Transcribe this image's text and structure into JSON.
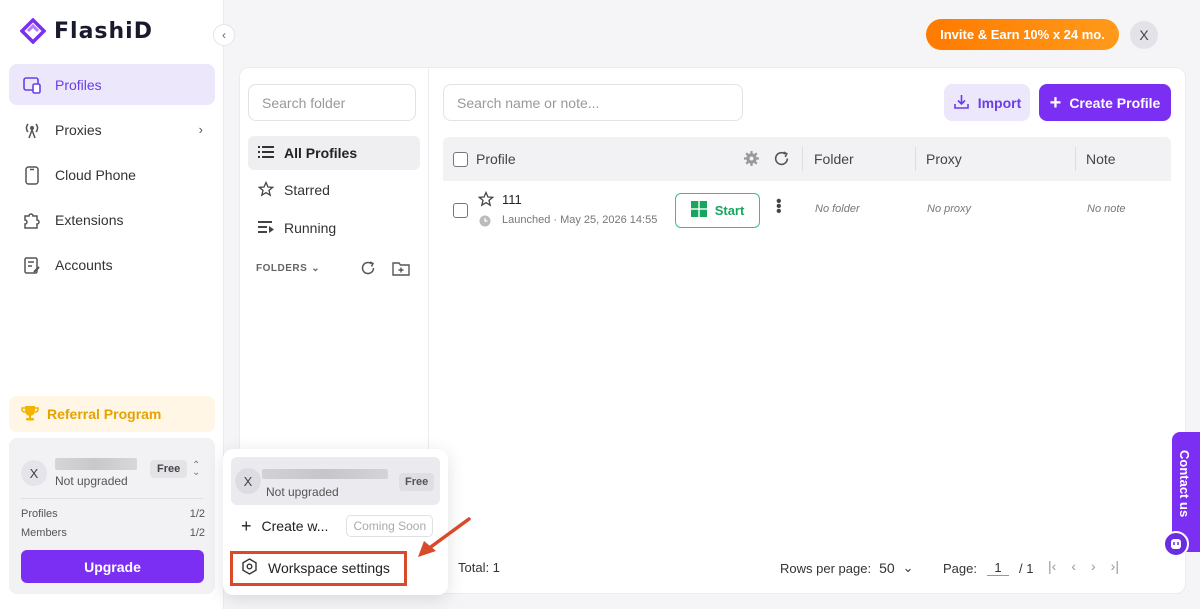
{
  "app": {
    "name": "FlashiD"
  },
  "sidebar": {
    "items": [
      {
        "label": "Profiles",
        "icon": "profiles-icon",
        "active": true
      },
      {
        "label": "Proxies",
        "icon": "proxy-icon"
      },
      {
        "label": "Cloud Phone",
        "icon": "phone-icon"
      },
      {
        "label": "Extensions",
        "icon": "extensions-icon"
      },
      {
        "label": "Accounts",
        "icon": "accounts-icon"
      }
    ],
    "referral": "Referral Program",
    "account": {
      "avatar": "X",
      "status": "Not upgraded",
      "plan": "Free",
      "profiles_label": "Profiles",
      "profiles_value": "1/2",
      "members_label": "Members",
      "members_value": "1/2",
      "upgrade": "Upgrade"
    }
  },
  "topbar": {
    "invite": "Invite & Earn 10% x 24 mo.",
    "avatar": "X"
  },
  "folders": {
    "search_placeholder": "Search folder",
    "items": [
      "All Profiles",
      "Starred",
      "Running"
    ],
    "header": "FOLDERS"
  },
  "toolbar": {
    "search_placeholder": "Search name or note...",
    "import": "Import",
    "create": "Create Profile"
  },
  "table": {
    "columns": [
      "Profile",
      "Folder",
      "Proxy",
      "Note"
    ],
    "rows": [
      {
        "name": "111",
        "launched": "Launched · May 25, 2026 14:55",
        "start": "Start",
        "folder": "No folder",
        "proxy": "No proxy",
        "note": "No note"
      }
    ]
  },
  "footer": {
    "total": "Total: 1",
    "rows_per_page_label": "Rows per page:",
    "rows_per_page": "50",
    "page_label": "Page:",
    "page": "1",
    "page_total": "/ 1"
  },
  "popup": {
    "avatar": "X",
    "status": "Not upgraded",
    "plan": "Free",
    "create_workspace": "Create w...",
    "coming_soon": "Coming Soon",
    "workspace_settings": "Workspace settings"
  },
  "contact": "Contact us",
  "colors": {
    "accent": "#7b2ff2",
    "orange": "#ff8a00",
    "start_green": "#17a560",
    "highlight": "#d94a2b"
  }
}
